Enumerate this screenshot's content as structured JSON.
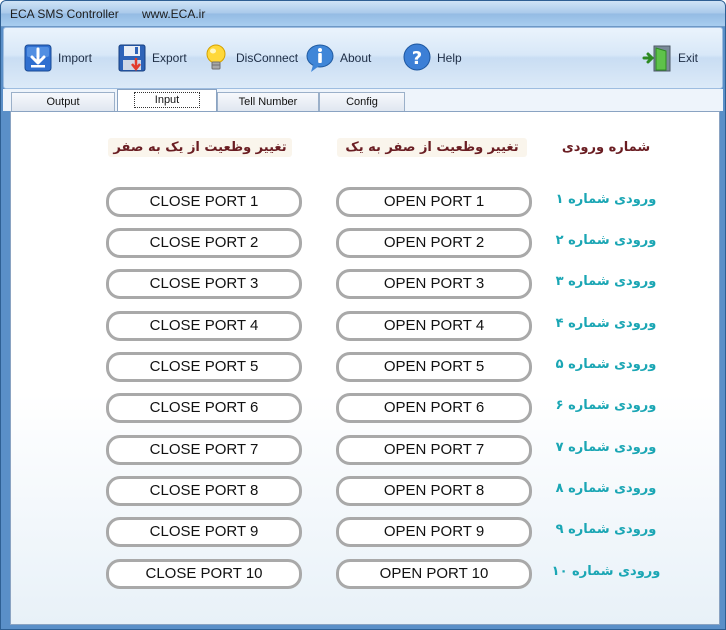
{
  "window": {
    "app_title": "ECA SMS Controller",
    "url": "www.ECA.ir"
  },
  "toolbar": {
    "import": "Import",
    "export": "Export",
    "disconnect": "DisConnect",
    "about": "About",
    "help": "Help",
    "exit": "Exit"
  },
  "tabs": {
    "output": "Output",
    "input": "Input",
    "tell_number": "Tell Number",
    "config": "Config",
    "active": "Input"
  },
  "headers": {
    "close_col": "تغییر وظعیت از یک به صفر",
    "open_col": "تغییر وظعیت از صفر به یک",
    "input_col": "شماره ورودی"
  },
  "rows": [
    {
      "close": "CLOSE PORT 1",
      "open": "OPEN PORT 1",
      "input": "ورودی شماره ۱"
    },
    {
      "close": "CLOSE PORT 2",
      "open": "OPEN PORT 2",
      "input": "ورودی شماره ۲"
    },
    {
      "close": "CLOSE PORT 3",
      "open": "OPEN PORT 3",
      "input": "ورودی شماره ۳"
    },
    {
      "close": "CLOSE PORT 4",
      "open": "OPEN PORT 4",
      "input": "ورودی شماره ۴"
    },
    {
      "close": "CLOSE PORT 5",
      "open": "OPEN PORT 5",
      "input": "ورودی شماره ۵"
    },
    {
      "close": "CLOSE PORT 6",
      "open": "OPEN PORT 6",
      "input": "ورودی شماره ۶"
    },
    {
      "close": "CLOSE PORT 7",
      "open": "OPEN PORT 7",
      "input": "ورودی شماره ۷"
    },
    {
      "close": "CLOSE PORT 8",
      "open": "OPEN PORT 8",
      "input": "ورودی شماره ۸"
    },
    {
      "close": "CLOSE PORT 9",
      "open": "OPEN PORT 9",
      "input": "ورودی شماره ۹"
    },
    {
      "close": "CLOSE PORT 10",
      "open": "OPEN PORT 10",
      "input": "ورودی شماره ۱۰"
    }
  ],
  "icons": {
    "import": "download-arrow-icon",
    "export": "floppy-disk-icon",
    "disconnect": "lightbulb-icon",
    "about": "info-icon",
    "help": "question-icon",
    "exit": "exit-door-icon"
  }
}
